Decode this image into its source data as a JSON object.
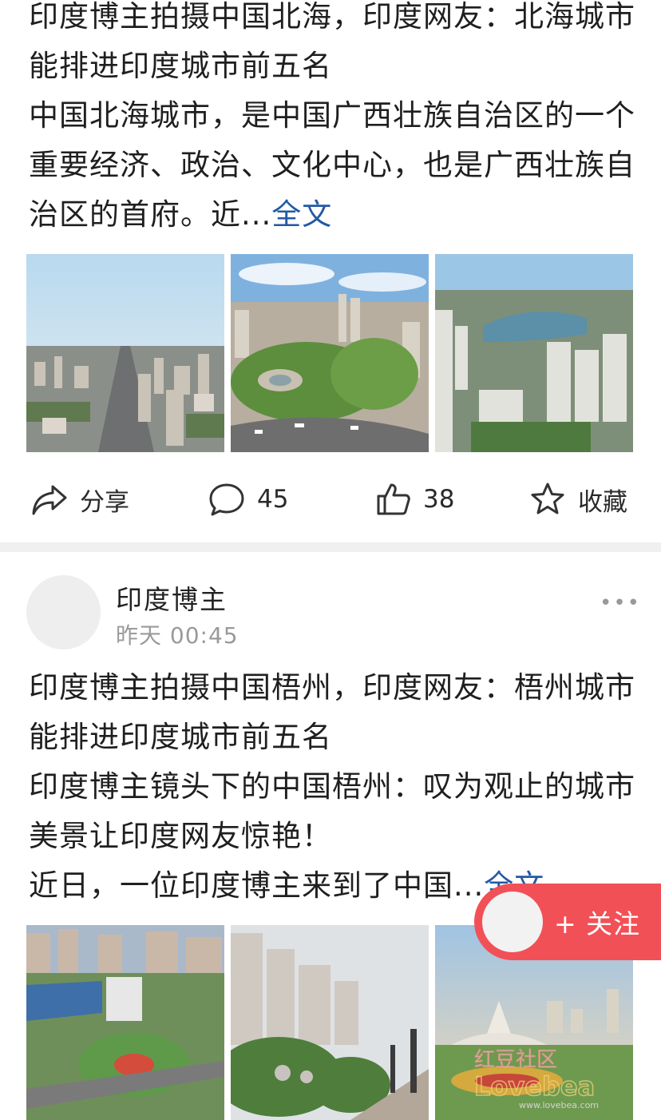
{
  "post1": {
    "title_line": "印度博主拍摄中国北海，印度网友：北海城市能排进印度城市前五名",
    "body": "中国北海城市，是中国广西壮族自治区的一个重要经济、政治、文化中心，也是广西壮族自治区的首府。近...",
    "more": "全文",
    "images": [
      "city-skyline-photo",
      "city-park-roundabout-photo",
      "city-lake-photo"
    ]
  },
  "actions": {
    "share_label": "分享",
    "comment_count": "45",
    "like_count": "38",
    "favorite_label": "收藏"
  },
  "post2": {
    "author_name": "印度博主",
    "time": "昨天 00:45",
    "more_icon": "more-dots-icon",
    "title_line": "印度博主拍摄中国梧州，印度网友：梧州城市能排进印度城市前五名",
    "body_line1": "印度博主镜头下的中国梧州：叹为观止的城市美景让印度网友惊艳！",
    "body_line2": "近日，一位印度博主来到了中国...",
    "more": "全文",
    "images": [
      "city-plaza-photo",
      "riverside-highrise-photo",
      "stadium-photo"
    ]
  },
  "follow": {
    "label": "+ 关注"
  },
  "watermark": {
    "cn": "红豆社区",
    "en": "Lovebea",
    "url": "www.lovebea.com"
  },
  "colors": {
    "link": "#2259a5",
    "follow_bg": "#f25057",
    "divider": "#f0f0f0"
  }
}
